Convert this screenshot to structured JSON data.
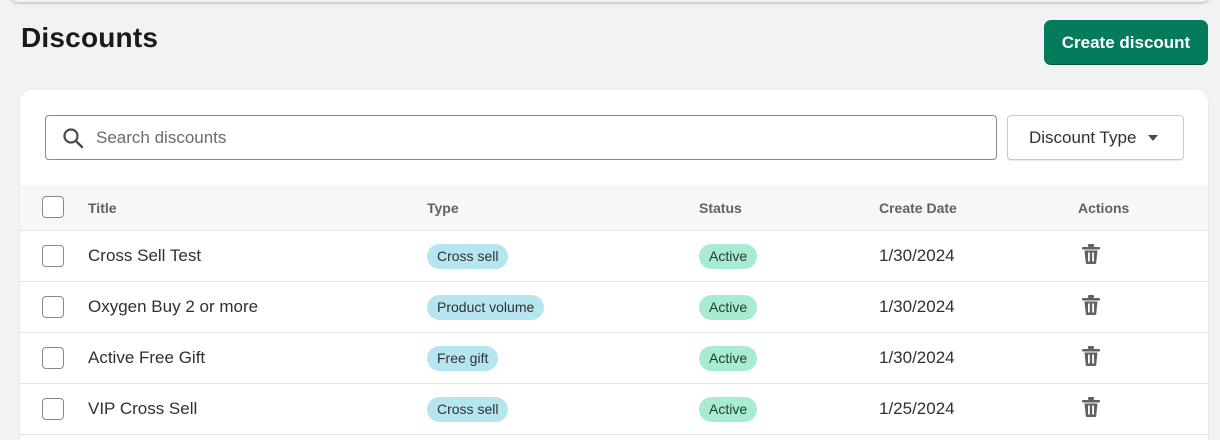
{
  "page": {
    "title": "Discounts",
    "create_button": "Create discount"
  },
  "search": {
    "placeholder": "Search discounts",
    "value": ""
  },
  "filter": {
    "label": "Discount Type"
  },
  "table": {
    "headers": {
      "title": "Title",
      "type": "Type",
      "status": "Status",
      "create_date": "Create Date",
      "actions": "Actions"
    },
    "rows": [
      {
        "title": "Cross Sell Test",
        "type": "Cross sell",
        "status": "Active",
        "create_date": "1/30/2024"
      },
      {
        "title": "Oxygen Buy 2 or more",
        "type": "Product volume",
        "status": "Active",
        "create_date": "1/30/2024"
      },
      {
        "title": "Active Free Gift",
        "type": "Free gift",
        "status": "Active",
        "create_date": "1/30/2024"
      },
      {
        "title": "VIP Cross Sell",
        "type": "Cross sell",
        "status": "Active",
        "create_date": "1/25/2024"
      }
    ]
  },
  "colors": {
    "primary": "#047b5d",
    "type_badge": "#b5e6ef",
    "status_badge": "#a7ecd1",
    "background": "#f1f2f4"
  },
  "icons": {
    "search": "search-icon",
    "caret": "caret-down-icon",
    "delete": "trash-icon"
  }
}
